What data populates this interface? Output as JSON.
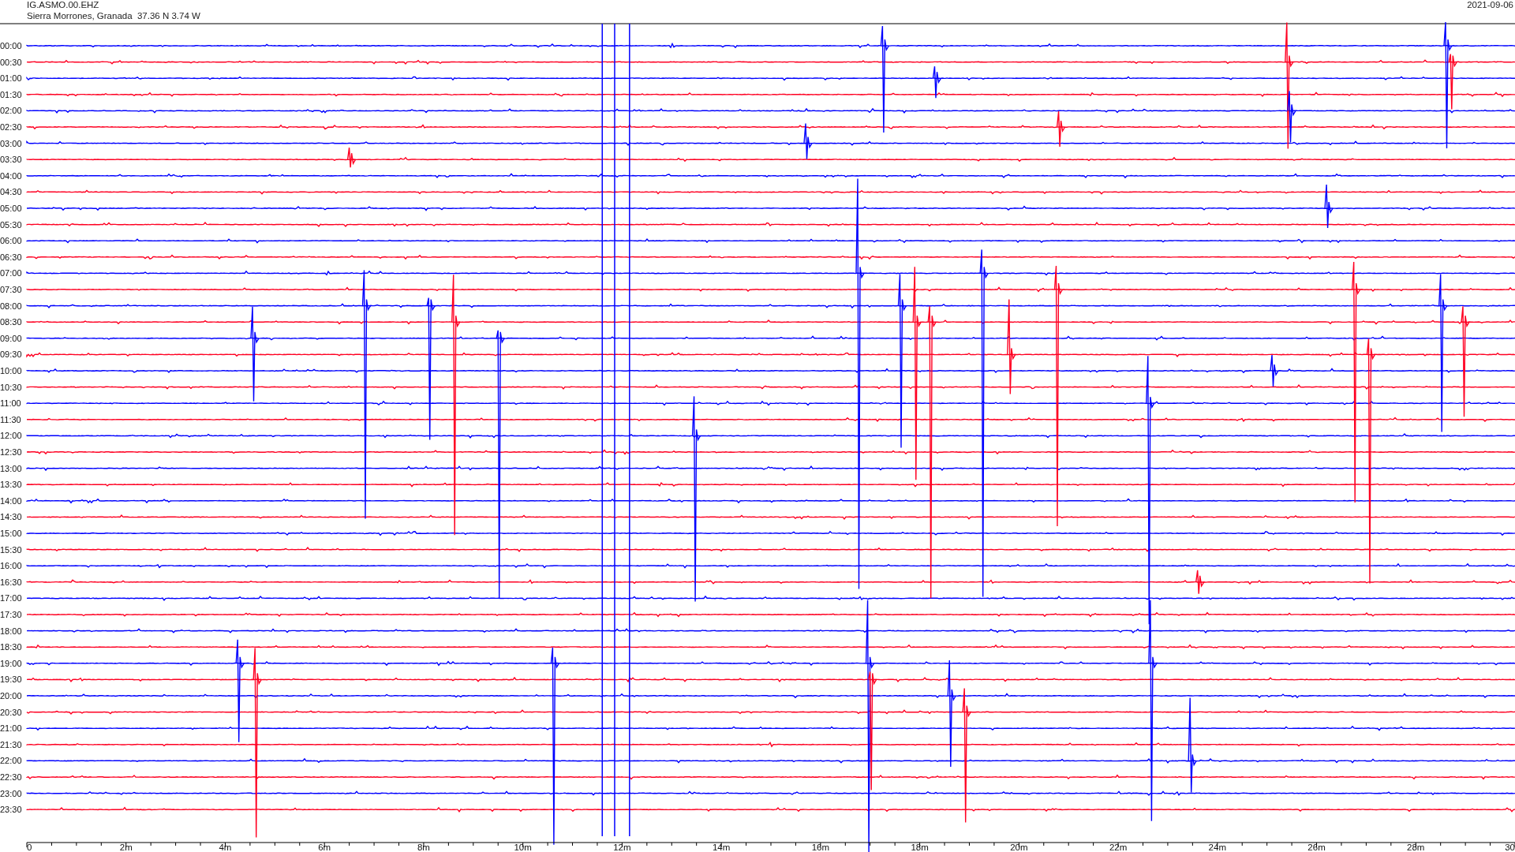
{
  "header": {
    "station": "IG.ASMO.00.EHZ",
    "location": "Sierra Morrones, Granada  37.36 N 3.74 W",
    "date": "2021-09-06"
  },
  "rows": [
    {
      "time": "00:00",
      "color": "#0000ff"
    },
    {
      "time": "00:30",
      "color": "#ff0022"
    },
    {
      "time": "01:00",
      "color": "#0000ff"
    },
    {
      "time": "01:30",
      "color": "#ff0022"
    },
    {
      "time": "02:00",
      "color": "#0000ff"
    },
    {
      "time": "02:30",
      "color": "#ff0022"
    },
    {
      "time": "03:00",
      "color": "#0000ff"
    },
    {
      "time": "03:30",
      "color": "#ff0022"
    },
    {
      "time": "04:00",
      "color": "#0000ff"
    },
    {
      "time": "04:30",
      "color": "#ff0022"
    },
    {
      "time": "05:00",
      "color": "#0000ff"
    },
    {
      "time": "05:30",
      "color": "#ff0022"
    },
    {
      "time": "06:00",
      "color": "#0000ff"
    },
    {
      "time": "06:30",
      "color": "#ff0022"
    },
    {
      "time": "07:00",
      "color": "#0000ff"
    },
    {
      "time": "07:30",
      "color": "#ff0022"
    },
    {
      "time": "08:00",
      "color": "#0000ff"
    },
    {
      "time": "08:30",
      "color": "#ff0022"
    },
    {
      "time": "09:00",
      "color": "#0000ff"
    },
    {
      "time": "09:30",
      "color": "#ff0022"
    },
    {
      "time": "10:00",
      "color": "#0000ff"
    },
    {
      "time": "10:30",
      "color": "#ff0022"
    },
    {
      "time": "11:00",
      "color": "#0000ff"
    },
    {
      "time": "11:30",
      "color": "#ff0022"
    },
    {
      "time": "12:00",
      "color": "#0000ff"
    },
    {
      "time": "12:30",
      "color": "#ff0022"
    },
    {
      "time": "13:00",
      "color": "#0000ff"
    },
    {
      "time": "13:30",
      "color": "#ff0022"
    },
    {
      "time": "14:00",
      "color": "#0000ff"
    },
    {
      "time": "14:30",
      "color": "#ff0022"
    },
    {
      "time": "15:00",
      "color": "#0000ff"
    },
    {
      "time": "15:30",
      "color": "#ff0022"
    },
    {
      "time": "16:00",
      "color": "#0000ff"
    },
    {
      "time": "16:30",
      "color": "#ff0022"
    },
    {
      "time": "17:00",
      "color": "#0000ff"
    },
    {
      "time": "17:30",
      "color": "#ff0022"
    },
    {
      "time": "18:00",
      "color": "#0000ff"
    },
    {
      "time": "18:30",
      "color": "#ff0022"
    },
    {
      "time": "19:00",
      "color": "#0000ff"
    },
    {
      "time": "19:30",
      "color": "#ff0022"
    },
    {
      "time": "20:00",
      "color": "#0000ff"
    },
    {
      "time": "20:30",
      "color": "#ff0022"
    },
    {
      "time": "21:00",
      "color": "#0000ff"
    },
    {
      "time": "21:30",
      "color": "#ff0022"
    },
    {
      "time": "22:00",
      "color": "#0000ff"
    },
    {
      "time": "22:30",
      "color": "#ff0022"
    },
    {
      "time": "23:00",
      "color": "#0000ff"
    },
    {
      "time": "23:30",
      "color": "#ff0022"
    }
  ],
  "x_axis": {
    "labels": [
      "0",
      "2m",
      "4m",
      "6m",
      "8m",
      "10m",
      "12m",
      "14m",
      "16m",
      "18m",
      "20m",
      "22m",
      "24m",
      "26m",
      "28m",
      "30"
    ]
  }
}
